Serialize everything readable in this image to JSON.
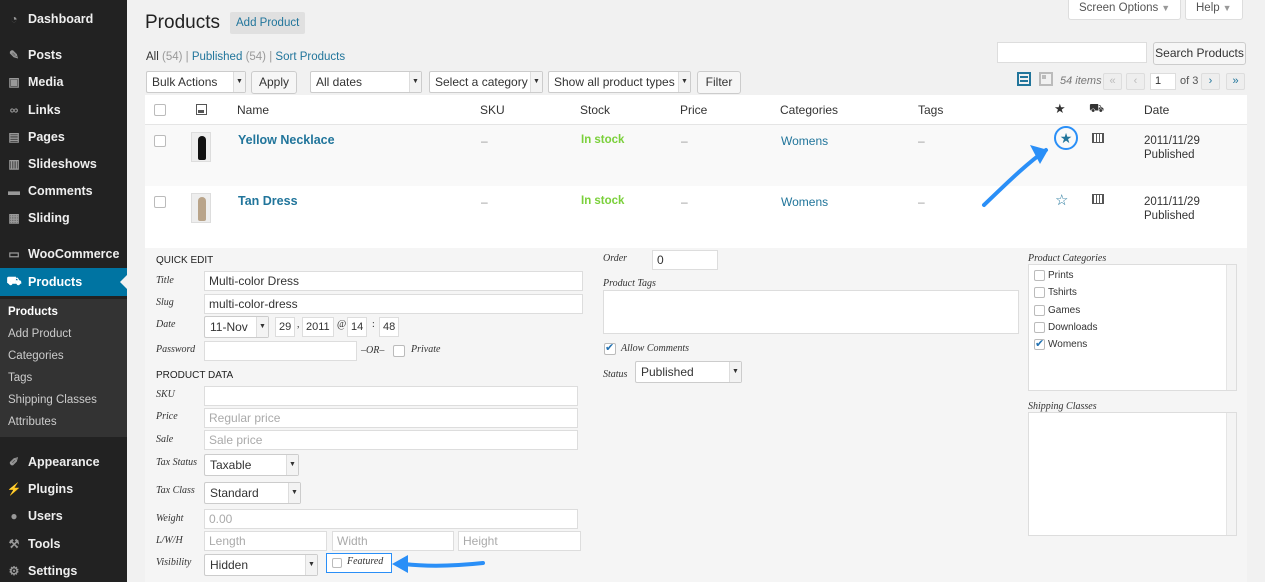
{
  "sidebar": {
    "items": [
      {
        "label": "Dashboard",
        "icon": "dashboard-icon"
      },
      {
        "label": "Posts",
        "icon": "pin-icon"
      },
      {
        "label": "Media",
        "icon": "media-icon"
      },
      {
        "label": "Links",
        "icon": "link-icon"
      },
      {
        "label": "Pages",
        "icon": "pages-icon"
      },
      {
        "label": "Slideshows",
        "icon": "slideshow-icon"
      },
      {
        "label": "Comments",
        "icon": "comment-icon"
      },
      {
        "label": "Sliding",
        "icon": "sliding-icon"
      },
      {
        "label": "WooCommerce",
        "icon": "woocommerce-icon"
      },
      {
        "label": "Products",
        "icon": "cart-icon"
      },
      {
        "label": "Appearance",
        "icon": "brush-icon"
      },
      {
        "label": "Plugins",
        "icon": "plugin-icon"
      },
      {
        "label": "Users",
        "icon": "user-icon"
      },
      {
        "label": "Tools",
        "icon": "wrench-icon"
      },
      {
        "label": "Settings",
        "icon": "settings-icon"
      }
    ],
    "submenu": [
      "Products",
      "Add Product",
      "Categories",
      "Tags",
      "Shipping Classes",
      "Attributes"
    ]
  },
  "header": {
    "title": "Products",
    "add_button": "Add Product",
    "screen_options": "Screen Options",
    "help": "Help"
  },
  "views": {
    "all": "All",
    "all_count": "(54)",
    "published": "Published",
    "published_count": "(54)",
    "sort": "Sort Products",
    "sep": "|"
  },
  "toolbar": {
    "bulk_actions": "Bulk Actions",
    "apply": "Apply",
    "dates": "All dates",
    "category": "Select a category",
    "product_types": "Show all product types",
    "filter": "Filter",
    "search_button": "Search Products",
    "items": "54 items",
    "page": "1",
    "of_pages": "of 3",
    "first": "«",
    "prev": "‹",
    "next": "›",
    "last": "»"
  },
  "table": {
    "columns": {
      "name": "Name",
      "sku": "SKU",
      "stock": "Stock",
      "price": "Price",
      "categories": "Categories",
      "tags": "Tags",
      "date": "Date"
    },
    "rows": [
      {
        "name": "Yellow Necklace",
        "sku": "–",
        "stock": "In stock",
        "price": "–",
        "category": "Womens",
        "tags": "–",
        "date": "2011/11/29",
        "status": "Published",
        "featured": true,
        "thumb_color": "#111111"
      },
      {
        "name": "Tan Dress",
        "sku": "–",
        "stock": "In stock",
        "price": "–",
        "category": "Womens",
        "tags": "–",
        "date": "2011/11/29",
        "status": "Published",
        "featured": false,
        "thumb_color": "#b9a48a"
      }
    ]
  },
  "quick_edit": {
    "heading": "QUICK EDIT",
    "title_label": "Title",
    "title_value": "Multi-color Dress",
    "slug_label": "Slug",
    "slug_value": "multi-color-dress",
    "date_label": "Date",
    "month": "11-Nov",
    "day": "29",
    "comma": ",",
    "year": "2011",
    "at": "@",
    "hour": "14",
    "colon": ":",
    "minute": "48",
    "password_label": "Password",
    "or": "–OR–",
    "private_label": "Private",
    "product_data_heading": "PRODUCT DATA",
    "sku_label": "SKU",
    "price_label": "Price",
    "price_placeholder": "Regular price",
    "sale_label": "Sale",
    "sale_placeholder": "Sale price",
    "tax_status_label": "Tax Status",
    "tax_status": "Taxable",
    "tax_class_label": "Tax Class",
    "tax_class": "Standard",
    "weight_label": "Weight",
    "weight_placeholder": "0.00",
    "lwh_label": "L/W/H",
    "length_placeholder": "Length",
    "width_placeholder": "Width",
    "height_placeholder": "Height",
    "visibility_label": "Visibility",
    "visibility": "Hidden",
    "featured_label": "Featured",
    "order_label": "Order",
    "order_value": "0",
    "product_tags_label": "Product Tags",
    "allow_comments_label": "Allow Comments",
    "status_label": "Status",
    "status_value": "Published",
    "product_categories_label": "Product Categories",
    "categories": [
      {
        "label": "Prints",
        "checked": false
      },
      {
        "label": "Tshirts",
        "checked": false
      },
      {
        "label": "Games",
        "checked": false
      },
      {
        "label": "Downloads",
        "checked": false
      },
      {
        "label": "Womens",
        "checked": true
      }
    ],
    "shipping_classes_label": "Shipping Classes"
  },
  "colors": {
    "sidebar_bg": "#222222",
    "active_blue": "#0074a2",
    "link_blue": "#21759b",
    "in_stock_green": "#7ad03a",
    "annotation_blue": "#2a8ff7"
  }
}
